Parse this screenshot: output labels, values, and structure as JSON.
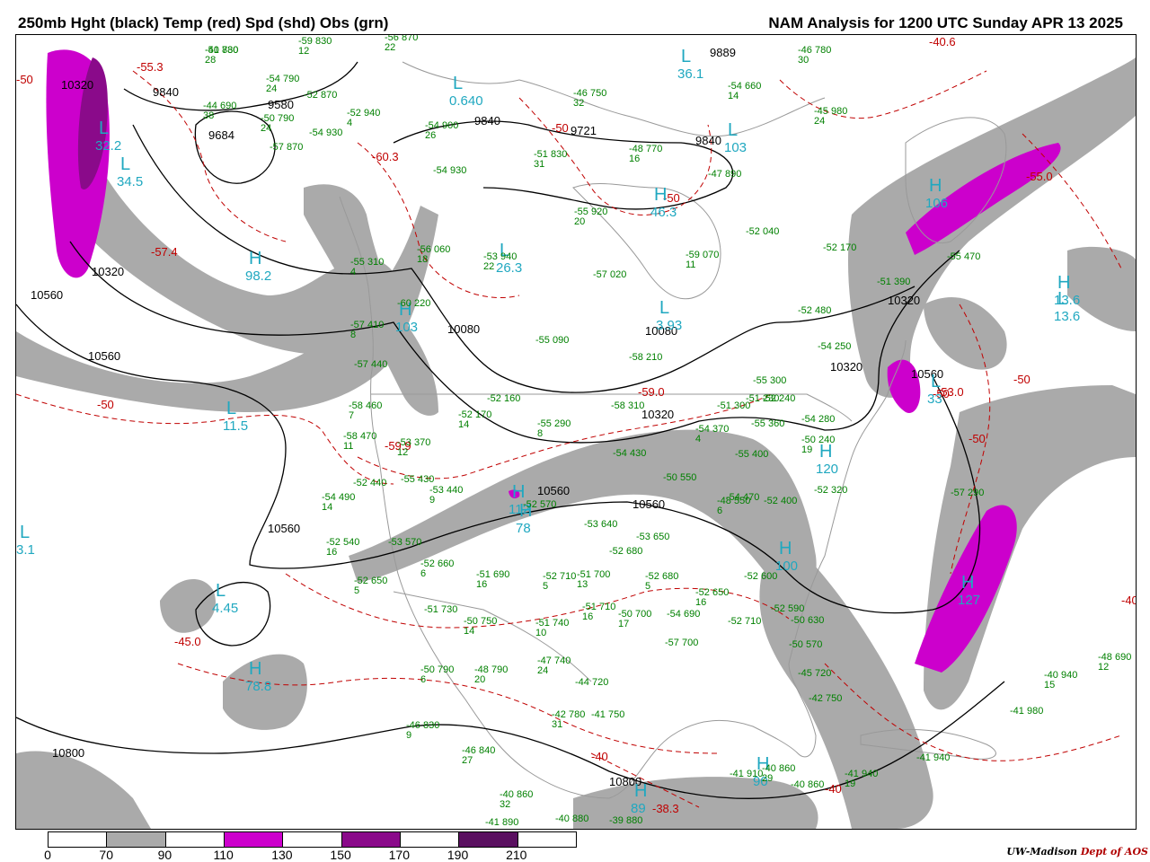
{
  "header": {
    "title_left": "250mb Hght (black) Temp (red) Spd (shd) Obs (grn)",
    "title_right": "NAM Analysis for 1200 UTC Sunday  APR 13 2025"
  },
  "colors": {
    "height_contour": "#000000",
    "temperature_contour": "#c00000",
    "observation_text": "#008000",
    "system_label": "#20a8c0",
    "wind_70_90": "#aaaaaa",
    "wind_110_130": "#cc00cc",
    "wind_130_150": "#b000b0",
    "wind_150_170": "#8a0a8a",
    "wind_190_210": "#5a1060",
    "coast": "#999999"
  },
  "legend": {
    "ticks": [
      "0",
      "70",
      "90",
      "110",
      "130",
      "150",
      "170",
      "190",
      "210"
    ],
    "cell_colors": [
      "#ffffff",
      "#aaaaaa",
      "#ffffff",
      "#cc00cc",
      "#ffffff",
      "#8a0a8a",
      "#ffffff",
      "#5a1060",
      "#ffffff"
    ]
  },
  "credit": {
    "org": "UW-Madison",
    "dept": "Dept of AOS"
  },
  "height_labels": [
    "10320",
    "9580",
    "9840",
    "9684",
    "9840",
    "9721",
    "9840",
    "9889",
    "10320",
    "10560",
    "10560",
    "10080",
    "10080",
    "10320",
    "10320",
    "10560",
    "10560",
    "10560",
    "10800",
    "10800",
    "10560",
    "10320"
  ],
  "temp_labels": [
    "-55.3",
    "-50",
    "-60.3",
    "-57.4",
    "-50",
    "-50",
    "-59.0",
    "-59.9",
    "-50",
    "-45.0",
    "-40",
    "-40.6",
    "-55.0",
    "-50",
    "-53.0",
    "-50",
    "-50",
    "-40",
    "-38.3",
    "-40"
  ],
  "systems": [
    {
      "type": "L",
      "value": "0.640"
    },
    {
      "type": "L",
      "value": "36.1"
    },
    {
      "type": "L",
      "value": "103"
    },
    {
      "type": "H",
      "value": "46.3"
    },
    {
      "type": "L",
      "value": "26.3"
    },
    {
      "type": "L",
      "value": "3.93"
    },
    {
      "type": "H",
      "value": "13.6"
    },
    {
      "type": "L",
      "value": "13.6"
    },
    {
      "type": "H",
      "value": "98.2"
    },
    {
      "type": "H",
      "value": "103"
    },
    {
      "type": "L",
      "value": "11.5"
    },
    {
      "type": "H",
      "value": "112"
    },
    {
      "type": "H",
      "value": "120"
    },
    {
      "type": "H",
      "value": "100"
    },
    {
      "type": "H",
      "value": "127"
    },
    {
      "type": "L",
      "value": "4.45"
    },
    {
      "type": "H",
      "value": "78.8"
    },
    {
      "type": "H",
      "value": "89"
    },
    {
      "type": "H",
      "value": "78"
    },
    {
      "type": "L",
      "value": "3.1"
    },
    {
      "type": "H",
      "value": "106"
    },
    {
      "type": "L",
      "value": "34.5"
    },
    {
      "type": "L",
      "value": "33"
    },
    {
      "type": "H",
      "value": "90"
    },
    {
      "type": "L",
      "value": "32.2"
    }
  ],
  "observations": [
    {
      "t": "-51",
      "h": "730",
      "w": "28"
    },
    {
      "t": "-59",
      "h": "830",
      "w": "12"
    },
    {
      "t": "-56",
      "h": "870",
      "w": "22"
    },
    {
      "t": "-54",
      "h": "790",
      "w": "24"
    },
    {
      "t": "-52",
      "h": "870",
      "w": ""
    },
    {
      "t": "-44",
      "h": "690",
      "w": "38"
    },
    {
      "t": "-50",
      "h": "790",
      "w": "24"
    },
    {
      "t": "-52",
      "h": "940",
      "w": "4"
    },
    {
      "t": "-54",
      "h": "930",
      "w": ""
    },
    {
      "t": "-57",
      "h": "870",
      "w": ""
    },
    {
      "t": "-54",
      "h": "900",
      "w": "26"
    },
    {
      "t": "-46",
      "h": "750",
      "w": "32"
    },
    {
      "t": "-51",
      "h": "830",
      "w": "31"
    },
    {
      "t": "-48",
      "h": "770",
      "w": "16"
    },
    {
      "t": "-54",
      "h": "660",
      "w": "14"
    },
    {
      "t": "-46",
      "h": "780",
      "w": "30"
    },
    {
      "t": "-45",
      "h": "980",
      "w": "24"
    },
    {
      "t": "-54",
      "h": "930",
      "w": ""
    },
    {
      "t": "-47",
      "h": "890",
      "w": ""
    },
    {
      "t": "-55",
      "h": "920",
      "w": "20"
    },
    {
      "t": "-52",
      "h": "040",
      "w": ""
    },
    {
      "t": "-52",
      "h": "170",
      "w": ""
    },
    {
      "t": "-55",
      "h": "470",
      "w": ""
    },
    {
      "t": "-51",
      "h": "390",
      "w": ""
    },
    {
      "t": "-59",
      "h": "070",
      "w": "11"
    },
    {
      "t": "-57",
      "h": "020",
      "w": ""
    },
    {
      "t": "-53",
      "h": "940",
      "w": "22"
    },
    {
      "t": "-56",
      "h": "060",
      "w": "18"
    },
    {
      "t": "-55",
      "h": "310",
      "w": "4"
    },
    {
      "t": "-60",
      "h": "220",
      "w": ""
    },
    {
      "t": "-57",
      "h": "410",
      "w": "8"
    },
    {
      "t": "-57",
      "h": "440",
      "w": ""
    },
    {
      "t": "-58",
      "h": "460",
      "w": "7"
    },
    {
      "t": "-58",
      "h": "470",
      "w": "11"
    },
    {
      "t": "-53",
      "h": "370",
      "w": "12"
    },
    {
      "t": "-52",
      "h": "440",
      "w": ""
    },
    {
      "t": "-55",
      "h": "430",
      "w": ""
    },
    {
      "t": "-54",
      "h": "490",
      "w": "14"
    },
    {
      "t": "-53",
      "h": "440",
      "w": "9"
    },
    {
      "t": "-52",
      "h": "540",
      "w": "16"
    },
    {
      "t": "-53",
      "h": "570",
      "w": ""
    },
    {
      "t": "-52",
      "h": "660",
      "w": "6"
    },
    {
      "t": "-52",
      "h": "650",
      "w": "5"
    },
    {
      "t": "-51",
      "h": "730",
      "w": ""
    },
    {
      "t": "-50",
      "h": "750",
      "w": "14"
    },
    {
      "t": "-51",
      "h": "690",
      "w": "16"
    },
    {
      "t": "-52",
      "h": "710",
      "w": "5"
    },
    {
      "t": "-51",
      "h": "740",
      "w": "10"
    },
    {
      "t": "-50",
      "h": "790",
      "w": "6"
    },
    {
      "t": "-48",
      "h": "790",
      "w": "20"
    },
    {
      "t": "-47",
      "h": "740",
      "w": "24"
    },
    {
      "t": "-46",
      "h": "830",
      "w": "9"
    },
    {
      "t": "-46",
      "h": "840",
      "w": "27"
    },
    {
      "t": "-40",
      "h": "860",
      "w": "32"
    },
    {
      "t": "-41",
      "h": "890",
      "w": ""
    },
    {
      "t": "-44",
      "h": "720",
      "w": ""
    },
    {
      "t": "-42",
      "h": "780",
      "w": "31"
    },
    {
      "t": "-41",
      "h": "750",
      "w": ""
    },
    {
      "t": "-40",
      "h": "880",
      "w": ""
    },
    {
      "t": "-39",
      "h": "880",
      "w": ""
    },
    {
      "t": "-51",
      "h": "700",
      "w": "13"
    },
    {
      "t": "-51",
      "h": "710",
      "w": "16"
    },
    {
      "t": "-50",
      "h": "700",
      "w": "17"
    },
    {
      "t": "-52",
      "h": "680",
      "w": "5"
    },
    {
      "t": "-52",
      "h": "650",
      "w": "16"
    },
    {
      "t": "-54",
      "h": "690",
      "w": ""
    },
    {
      "t": "-52",
      "h": "710",
      "w": ""
    },
    {
      "t": "-57",
      "h": "700",
      "w": ""
    },
    {
      "t": "-53",
      "h": "640",
      "w": ""
    },
    {
      "t": "-52",
      "h": "680",
      "w": ""
    },
    {
      "t": "-52",
      "h": "570",
      "w": ""
    },
    {
      "t": "-53",
      "h": "650",
      "w": ""
    },
    {
      "t": "-52",
      "h": "600",
      "w": ""
    },
    {
      "t": "-52",
      "h": "590",
      "w": ""
    },
    {
      "t": "-50",
      "h": "630",
      "w": ""
    },
    {
      "t": "-50",
      "h": "570",
      "w": ""
    },
    {
      "t": "-45",
      "h": "720",
      "w": ""
    },
    {
      "t": "-42",
      "h": "750",
      "w": ""
    },
    {
      "t": "-58",
      "h": "210",
      "w": ""
    },
    {
      "t": "-55",
      "h": "090",
      "w": ""
    },
    {
      "t": "-58",
      "h": "310",
      "w": ""
    },
    {
      "t": "-52",
      "h": "170",
      "w": "14"
    },
    {
      "t": "-52",
      "h": "160",
      "w": ""
    },
    {
      "t": "-55",
      "h": "290",
      "w": "8"
    },
    {
      "t": "-54",
      "h": "430",
      "w": ""
    },
    {
      "t": "-54",
      "h": "370",
      "w": "4"
    },
    {
      "t": "-55",
      "h": "400",
      "w": ""
    },
    {
      "t": "-50",
      "h": "550",
      "w": ""
    },
    {
      "t": "-48",
      "h": "550",
      "w": "6"
    },
    {
      "t": "-54",
      "h": "470",
      "w": ""
    },
    {
      "t": "-52",
      "h": "400",
      "w": ""
    },
    {
      "t": "-51",
      "h": "300",
      "w": ""
    },
    {
      "t": "-55",
      "h": "360",
      "w": ""
    },
    {
      "t": "-52",
      "h": "240",
      "w": ""
    },
    {
      "t": "-54",
      "h": "280",
      "w": ""
    },
    {
      "t": "-50",
      "h": "240",
      "w": "19"
    },
    {
      "t": "-51",
      "h": "230",
      "w": ""
    },
    {
      "t": "-55",
      "h": "300",
      "w": ""
    },
    {
      "t": "-52",
      "h": "320",
      "w": ""
    },
    {
      "t": "-52",
      "h": "480",
      "w": ""
    },
    {
      "t": "-54",
      "h": "250",
      "w": ""
    },
    {
      "t": "-57",
      "h": "290",
      "w": ""
    },
    {
      "t": "-48",
      "h": "690",
      "w": "12"
    },
    {
      "t": "-40",
      "h": "940",
      "w": "15"
    },
    {
      "t": "-41",
      "h": "980",
      "w": ""
    },
    {
      "t": "-41",
      "h": "940",
      "w": ""
    },
    {
      "t": "-41",
      "h": "940",
      "w": "19"
    },
    {
      "t": "-41",
      "h": "910",
      "w": ""
    },
    {
      "t": "-40",
      "h": "860",
      "w": "29"
    },
    {
      "t": "-40",
      "h": "860",
      "w": ""
    },
    {
      "t": "-40",
      "h": "880",
      "w": ""
    }
  ]
}
